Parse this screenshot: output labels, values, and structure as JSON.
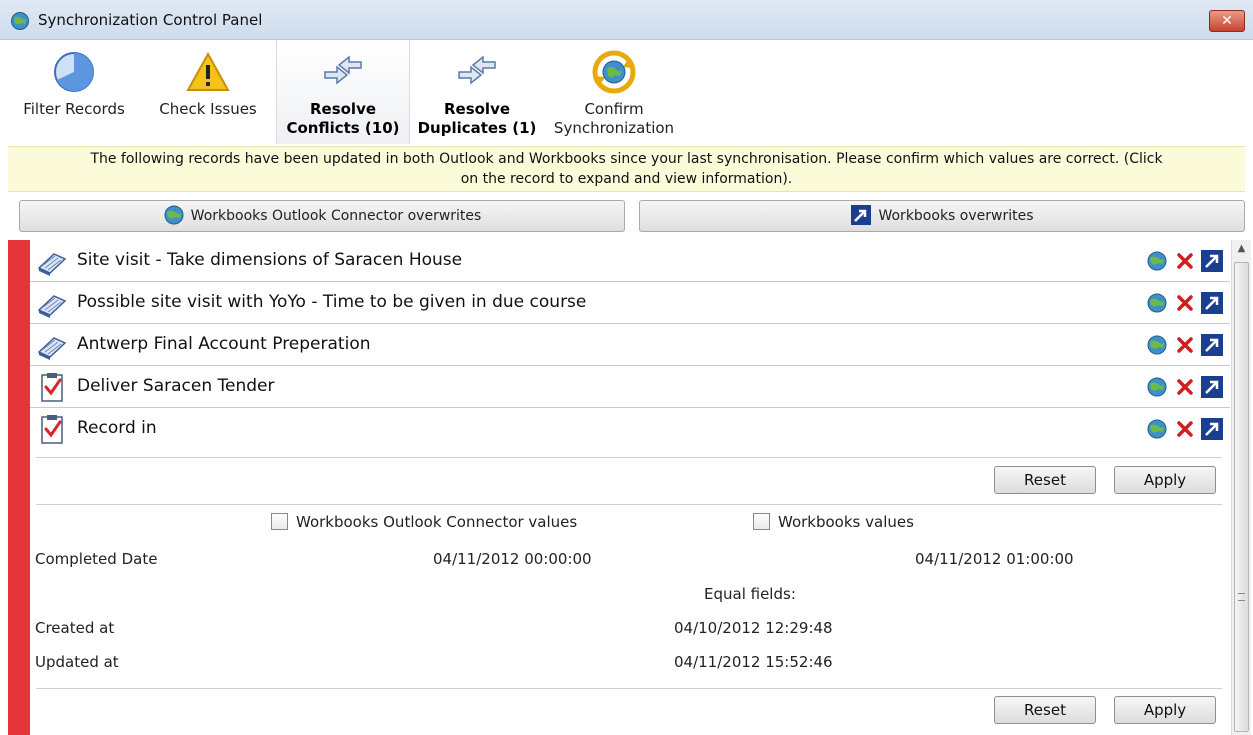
{
  "window": {
    "title": "Synchronization Control Panel",
    "close_label": "✕"
  },
  "toolbar": {
    "items": [
      {
        "label_1": "Filter Records",
        "label_2": ""
      },
      {
        "label_1": "Check Issues",
        "label_2": ""
      },
      {
        "label_1": "Resolve",
        "label_2": "Conflicts (10)"
      },
      {
        "label_1": "Resolve",
        "label_2": "Duplicates (1)"
      },
      {
        "label_1": "Confirm",
        "label_2": "Synchronization"
      }
    ]
  },
  "info": {
    "line_1": "The following records have been updated in both Outlook and Workbooks since your last synchronisation. Please confirm which values are correct. (Click",
    "line_2": "on the record to expand and view information)."
  },
  "overwrite": {
    "connector_label": "Workbooks Outlook Connector overwrites",
    "workbooks_label": "Workbooks overwrites"
  },
  "records": [
    {
      "name": "Site visit - Take dimensions of Saracen House",
      "type_icon": "appointment-icon"
    },
    {
      "name": "Possible site visit with YoYo - Time to be given in due course",
      "type_icon": "appointment-icon"
    },
    {
      "name": "Antwerp Final Account Preperation",
      "type_icon": "appointment-icon"
    },
    {
      "name": "Deliver Saracen Tender",
      "type_icon": "task-icon"
    },
    {
      "name": "Record in",
      "type_icon": "task-icon"
    }
  ],
  "detail": {
    "reset_label": "Reset",
    "apply_label": "Apply",
    "connector_values_label": "Workbooks Outlook Connector values",
    "workbooks_values_label": "Workbooks values",
    "completed_label": "Completed Date",
    "completed_connector": "04/11/2012 00:00:00",
    "completed_workbooks": "04/11/2012 01:00:00",
    "equal_fields_label": "Equal fields:",
    "created_label": "Created at",
    "created_value": "04/10/2012 12:29:48",
    "updated_label": "Updated at",
    "updated_value": "04/11/2012 15:52:46"
  },
  "colors": {
    "conflict_bar": "#e3343b",
    "info_bg": "#fbfbd9",
    "delete_x": "#d11f1f"
  }
}
